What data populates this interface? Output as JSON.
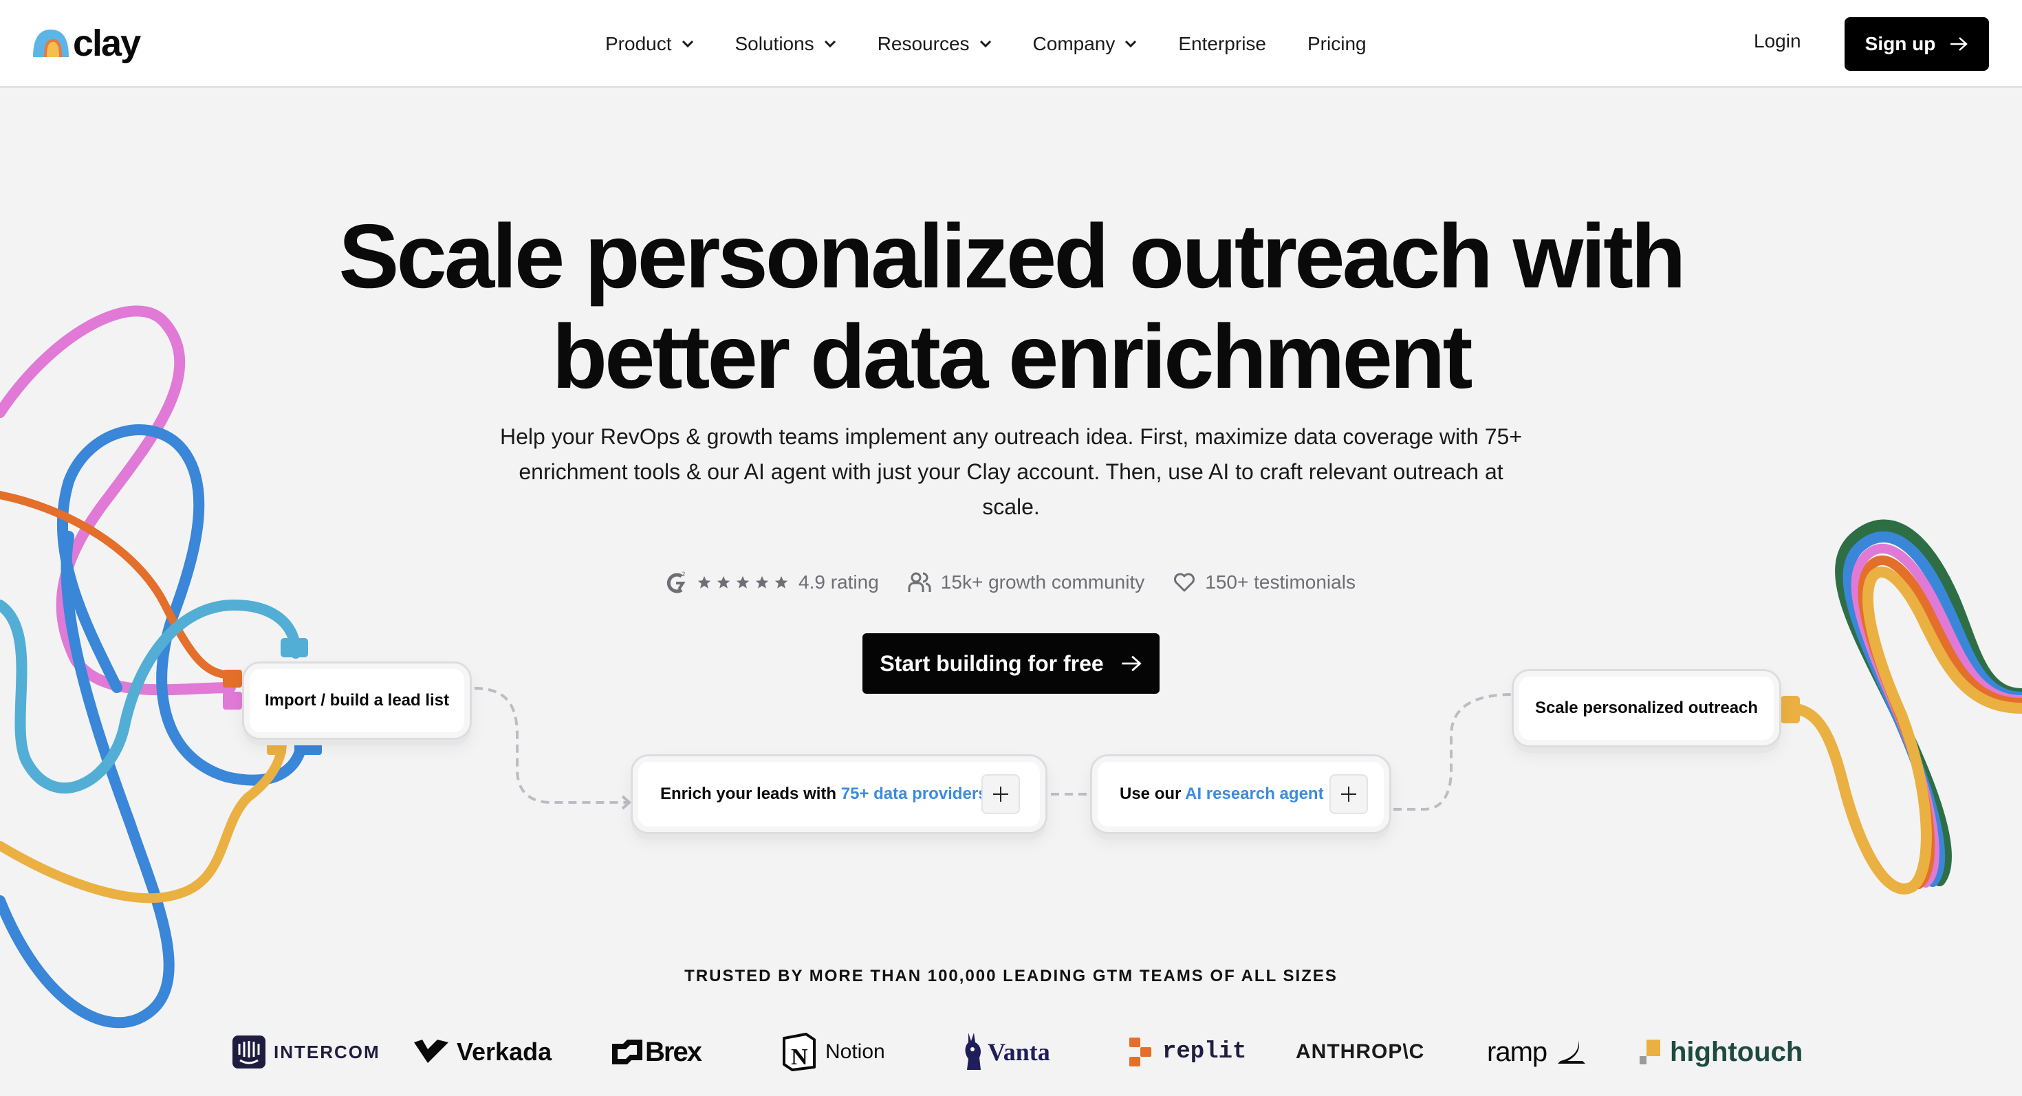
{
  "nav": {
    "brand": "clay",
    "items": [
      {
        "label": "Product",
        "dropdown": true
      },
      {
        "label": "Solutions",
        "dropdown": true
      },
      {
        "label": "Resources",
        "dropdown": true
      },
      {
        "label": "Company",
        "dropdown": true
      },
      {
        "label": "Enterprise",
        "dropdown": false
      },
      {
        "label": "Pricing",
        "dropdown": false
      }
    ],
    "login": "Login",
    "signup": "Sign up"
  },
  "hero": {
    "headline_line1": "Scale personalized outreach with",
    "headline_line2": "better data enrichment",
    "subtitle": "Help your RevOps & growth teams implement any outreach idea. First, maximize data coverage with 75+ enrichment tools & our AI agent with just your Clay account. Then, use AI to craft relevant outreach at scale.",
    "proof": {
      "rating_icon": "g2-icon",
      "stars": 5,
      "rating": "4.9 rating",
      "community": "15k+ growth community",
      "testimonials": "150+ testimonials"
    },
    "cta": "Start building for free"
  },
  "flow": {
    "import": "Import / build a lead list",
    "enrich_prefix": "Enrich your leads with ",
    "enrich_highlight": "75+ data providers",
    "agent_prefix": "Use our ",
    "agent_highlight": "AI research agent",
    "scale": "Scale personalized outreach"
  },
  "trusted": {
    "heading": "TRUSTED BY MORE THAN 100,000 LEADING GTM TEAMS OF ALL SIZES",
    "logos": [
      "INTERCOM",
      "Verkada",
      "Brex",
      "Notion",
      "Vanta",
      "replit",
      "ANTHROP\\C",
      "ramp",
      "hightouch"
    ]
  },
  "colors": {
    "accent_link": "#3b8be0",
    "tube_pink": "#e07ad6",
    "tube_blue": "#3a86d8",
    "tube_cyan": "#52aed4",
    "tube_orange": "#e36f2a",
    "tube_yellow": "#eab042",
    "tube_green": "#2e6e45"
  }
}
